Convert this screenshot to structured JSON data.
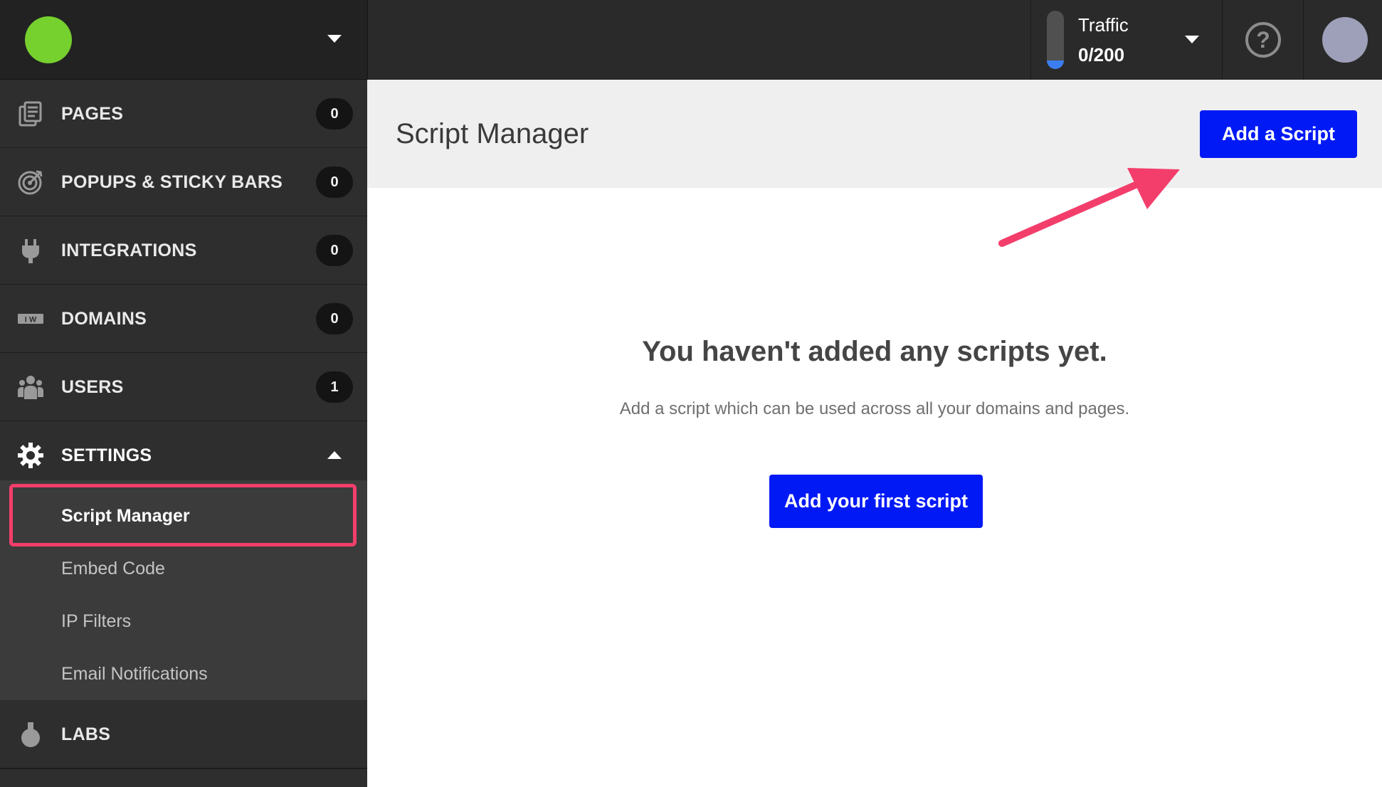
{
  "sidebar": {
    "items": [
      {
        "label": "PAGES",
        "count": "0",
        "icon": "pages-icon"
      },
      {
        "label": "POPUPS & STICKY BARS",
        "count": "0",
        "icon": "target-icon"
      },
      {
        "label": "INTEGRATIONS",
        "count": "0",
        "icon": "plug-icon"
      },
      {
        "label": "DOMAINS",
        "count": "0",
        "icon": "domain-icon"
      },
      {
        "label": "USERS",
        "count": "1",
        "icon": "users-icon"
      },
      {
        "label": "SETTINGS",
        "icon": "gear-icon"
      },
      {
        "label": "LABS",
        "icon": "flask-icon"
      }
    ],
    "settings_submenu": [
      {
        "label": "Script Manager",
        "active": true
      },
      {
        "label": "Embed Code"
      },
      {
        "label": "IP Filters"
      },
      {
        "label": "Email Notifications"
      }
    ]
  },
  "topbar": {
    "traffic": {
      "title": "Traffic",
      "value": "0/200",
      "used_fraction": 0.0
    },
    "help_icon": "help-icon",
    "avatar": "avatar"
  },
  "main": {
    "title": "Script Manager",
    "add_button": "Add a Script",
    "empty_title": "You haven't added any scripts yet.",
    "empty_text": "Add a script which can be used across all your domains and pages.",
    "first_button": "Add your first script"
  },
  "colors": {
    "brand_logo": "#76d12f",
    "primary_button": "#0019f5",
    "annotation": "#f33e6c",
    "traffic_fill": "#3b7ef2"
  }
}
